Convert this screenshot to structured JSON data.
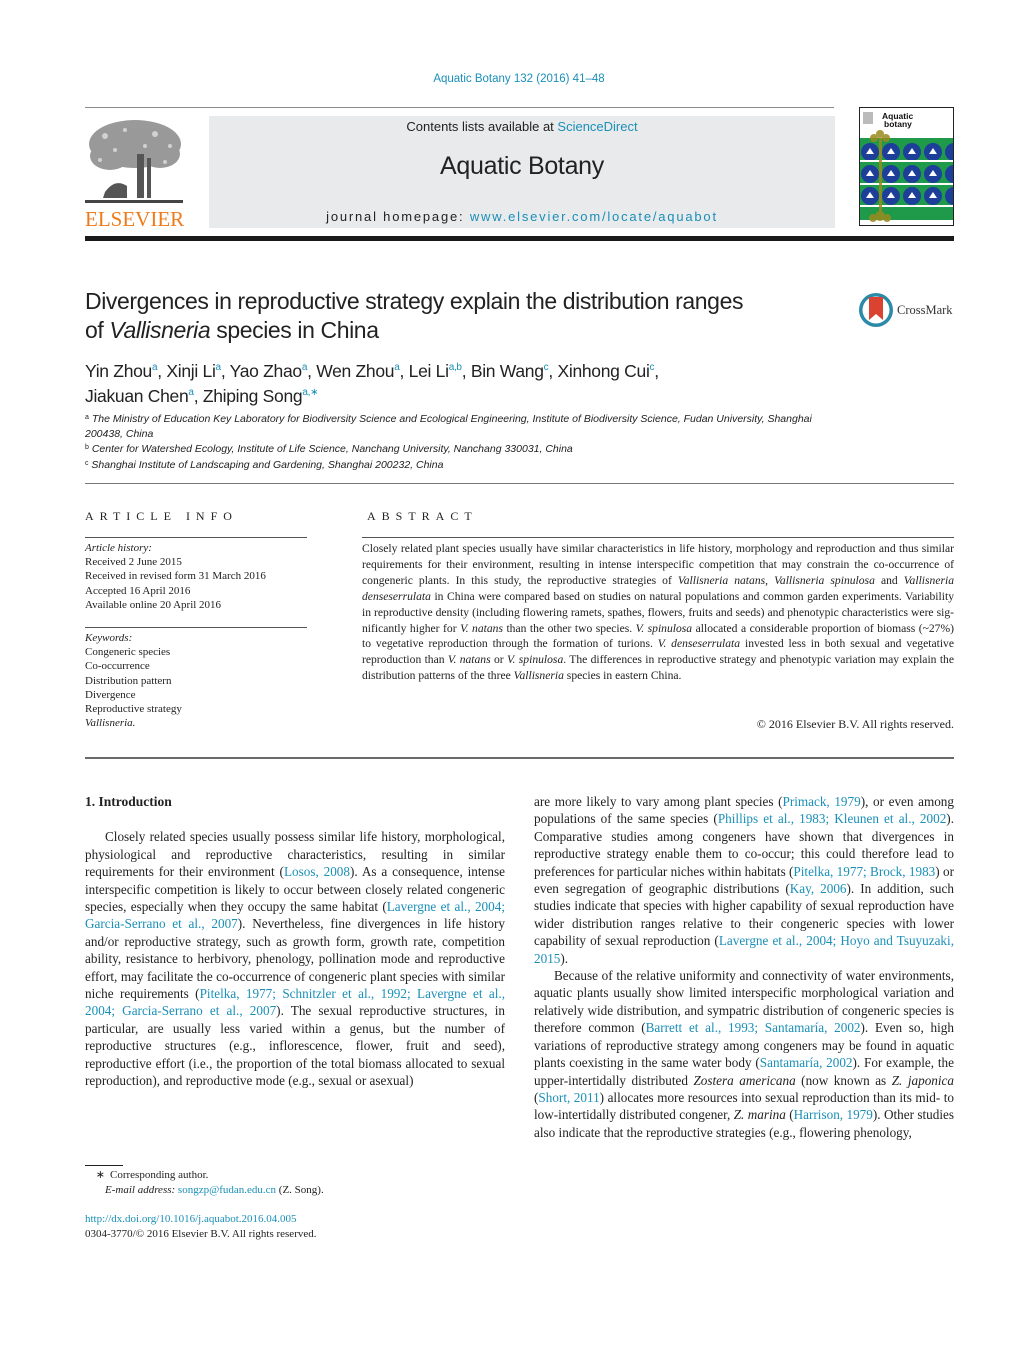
{
  "header": {
    "journal_ref": "Aquatic Botany 132 (2016) 41–48",
    "contents_prefix": "Contents lists available at ",
    "contents_link": "ScienceDirect",
    "journal_title": "Aquatic Botany",
    "homepage_prefix": "journal homepage: ",
    "homepage_link": "www.elsevier.com/locate/aquabot",
    "publisher_logo_text": "ELSEVIER",
    "cover_title_line1": "Aquatic",
    "cover_title_line2": "botany",
    "crossmark_label": "CrossMark"
  },
  "article": {
    "title_line1": "Divergences in reproductive strategy explain the distribution ranges",
    "title_line2_prefix": "of ",
    "title_line2_italic": "Vallisneria",
    "title_line2_suffix": " species in China",
    "authors": [
      {
        "name": "Yin Zhou",
        "aff": "a",
        "sep": ", "
      },
      {
        "name": "Xinji Li",
        "aff": "a",
        "sep": ", "
      },
      {
        "name": "Yao Zhao",
        "aff": "a",
        "sep": ", "
      },
      {
        "name": "Wen Zhou",
        "aff": "a",
        "sep": ", "
      },
      {
        "name": "Lei Li",
        "aff": "a,b",
        "sep": ", "
      },
      {
        "name": "Bin Wang",
        "aff": "c",
        "sep": ", "
      },
      {
        "name": "Xinhong Cui",
        "aff": "c",
        "sep": ","
      },
      {
        "name": "Jiakuan Chen",
        "aff": "a",
        "sep": ", "
      },
      {
        "name": "Zhiping Song",
        "aff": "a,∗",
        "sep": ""
      }
    ],
    "affiliations": [
      {
        "key": "a",
        "text": "The Ministry of Education Key Laboratory for Biodiversity Science and Ecological Engineering, Institute of Biodiversity Science, Fudan University, Shanghai 200438, China"
      },
      {
        "key": "b",
        "text": "Center for Watershed Ecology, Institute of Life Science, Nanchang University, Nanchang 330031, China"
      },
      {
        "key": "c",
        "text": "Shanghai Institute of Landscaping and Gardening, Shanghai 200232, China"
      }
    ]
  },
  "article_info": {
    "label": "ARTICLE INFO",
    "history_label": "Article history:",
    "history": [
      "Received 2 June 2015",
      "Received in revised form 31 March 2016",
      "Accepted 16 April 2016",
      "Available online 20 April 2016"
    ],
    "keywords_label": "Keywords:",
    "keywords": [
      "Congeneric species",
      "Co-occurrence",
      "Distribution pattern",
      "Divergence",
      "Reproductive strategy"
    ],
    "keyword_last_italic": "Vallisneria."
  },
  "abstract": {
    "label": "ABSTRACT",
    "segments": [
      {
        "t": "Closely related plant species usually have similar characteristics in life history, morphology and reproduc­tion and thus similar requirements for their environment, resulting in intense interspecific competition that may constrain the co-occurrence of congeneric plants. In this study, the reproductive strategies of "
      },
      {
        "t": "Vallisneria natans",
        "i": true
      },
      {
        "t": ", "
      },
      {
        "t": "Vallisneria spinulosa",
        "i": true
      },
      {
        "t": " and "
      },
      {
        "t": "Vallisneria denseserrulata",
        "i": true
      },
      {
        "t": " in China were compared based on studies on natural populations and common garden experiments. Variability in reproductive density (including flowering ramets, spathes, flowers, fruits and seeds) and phenotypic characteristics were sig­nificantly higher for "
      },
      {
        "t": "V. natans",
        "i": true
      },
      {
        "t": " than the other two species. "
      },
      {
        "t": "V. spinulosa",
        "i": true
      },
      {
        "t": " allocated a considerable proportion of biomass (~27%) to vegetative reproduction through the formation of turions. "
      },
      {
        "t": "V. denseserrulata",
        "i": true
      },
      {
        "t": " invested less in both sexual and vegetative reproduction than "
      },
      {
        "t": "V. natans",
        "i": true
      },
      {
        "t": " or "
      },
      {
        "t": "V. spinulosa",
        "i": true
      },
      {
        "t": ". The differences in repro­ductive strategy and phenotypic variation may explain the distribution patterns of the three "
      },
      {
        "t": "Vallisneria",
        "i": true
      },
      {
        "t": " species in eastern China."
      }
    ],
    "copyright": "© 2016 Elsevier B.V. All rights reserved."
  },
  "body": {
    "section_heading": "1.  Introduction",
    "left_paragraph": [
      {
        "t": "Closely related species usually possess similar life history, morphological, physiological and reproductive characteristics, resulting in similar requirements for their environment ("
      },
      {
        "t": "Losos, 2008",
        "l": true
      },
      {
        "t": "). As a consequence, intense interspecific competition is likely to occur between closely related congeneric species, especially when they occupy the same habitat ("
      },
      {
        "t": "Lavergne et al., 2004; Garcia-Serrano et al., 2007",
        "l": true
      },
      {
        "t": "). Nevertheless, fine divergences in life history and/or reproductive strategy, such as growth form, growth rate, competition ability, resistance to herbivory, phenology, pollination mode and reproductive effort, may facilitate the co-occurrence of congeneric plant species with similar niche requirements ("
      },
      {
        "t": "Pitelka, 1977; Schnitzler et al., 1992; Lavergne et al., 2004; Garcia-Serrano et al., 2007",
        "l": true
      },
      {
        "t": "). The sexual reproductive structures, in particular, are usually less varied within a genus, but the number of reproductive structures (e.g., inflorescence, flower, fruit and seed), reproductive effort (i.e., the proportion of the total biomass allocated to sex­ual reproduction), and reproductive mode (e.g., sexual or asexual)"
      }
    ],
    "right_paragraph_1": [
      {
        "t": "are more likely to vary among plant species ("
      },
      {
        "t": "Primack, 1979",
        "l": true
      },
      {
        "t": "), or even among populations of the same species ("
      },
      {
        "t": "Phillips et al., 1983; Kleunen et al., 2002",
        "l": true
      },
      {
        "t": "). Comparative studies among congeners have shown that divergences in reproductive strategy enable them to co-occur; this could therefore lead to preferences for particular niches within habitats ("
      },
      {
        "t": "Pitelka, 1977; Brock, 1983",
        "l": true
      },
      {
        "t": ") or even segregation of geographic distributions ("
      },
      {
        "t": "Kay, 2006",
        "l": true
      },
      {
        "t": "). In addition, such studies indicate that species with higher capability of sexual reproduction have wider distribution ranges relative to their congeneric species with lower capability of sexual reproduction ("
      },
      {
        "t": "Lavergne et al., 2004; Hoyo and Tsuyuzaki, 2015",
        "l": true
      },
      {
        "t": ")."
      }
    ],
    "right_paragraph_2": [
      {
        "t": "Because of the relative uniformity and connectivity of water environments, aquatic plants usually show limited interspecific morphological variation and relatively wide distribution, and sym­patric distribution of congeneric species is therefore common ("
      },
      {
        "t": "Barrett et al., 1993; Santamaría, 2002",
        "l": true
      },
      {
        "t": "). Even so, high variations of reproductive strategy among congeners may be found in aquatic plants coexisting in the same water body ("
      },
      {
        "t": "Santamaría, 2002",
        "l": true
      },
      {
        "t": "). For example, the upper-intertidally distributed "
      },
      {
        "t": "Zostera americana",
        "i": true
      },
      {
        "t": " (now known as "
      },
      {
        "t": "Z. japonica",
        "i": true
      },
      {
        "t": " ("
      },
      {
        "t": "Short, 2011",
        "l": true
      },
      {
        "t": ") allocates more resources into sexual reproduction than its mid- to low-intertidally distributed congener, "
      },
      {
        "t": "Z. marina",
        "i": true
      },
      {
        "t": " ("
      },
      {
        "t": "Harrison, 1979",
        "l": true
      },
      {
        "t": "). Other studies also indi­cate that the reproductive strategies (e.g., flowering phenology,"
      }
    ]
  },
  "footnotes": {
    "star": "∗",
    "corresponding": "Corresponding author.",
    "email_label": "E-mail address:",
    "email": "songzp@fudan.edu.cn",
    "email_suffix": " (Z. Song).",
    "doi": "http://dx.doi.org/10.1016/j.aquabot.2016.04.005",
    "issn_copyright": "0304-3770/© 2016 Elsevier B.V. All rights reserved."
  },
  "colors": {
    "link": "#1a8fb8",
    "elsevier_orange": "#f07a1a",
    "header_gray": "#e9eaeb",
    "cover_green": "#1e9a4a",
    "cover_blue": "#1d3f9a",
    "cover_olive": "#9a8a1e",
    "crossmark_red": "#d9432f"
  }
}
